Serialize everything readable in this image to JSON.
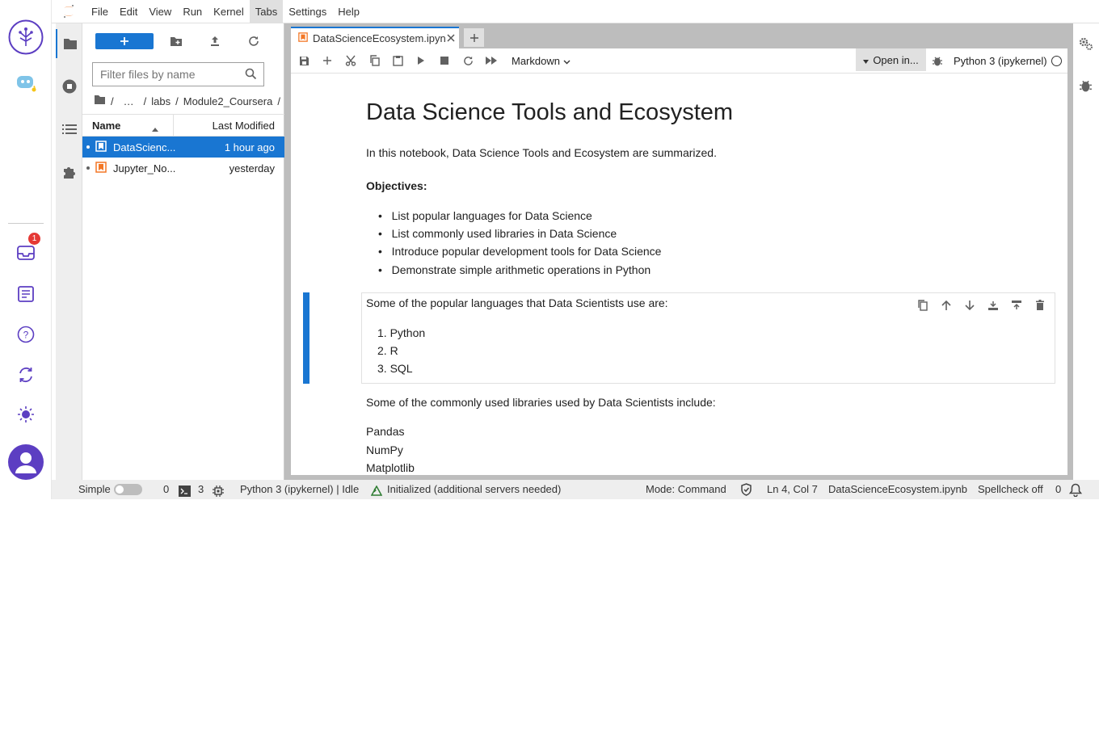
{
  "menubar": {
    "items": [
      "File",
      "Edit",
      "View",
      "Run",
      "Kernel",
      "Tabs",
      "Settings",
      "Help"
    ]
  },
  "rail": {
    "notification_count": "1"
  },
  "filebrowser": {
    "filter_placeholder": "Filter files by name",
    "breadcrumb": {
      "root": "/",
      "ellipsis": "…",
      "path1": "labs",
      "path2": "Module2_Coursera",
      "sep": "/"
    },
    "columns": {
      "name": "Name",
      "modified": "Last Modified"
    },
    "files": [
      {
        "name": "DataScienc...",
        "modified": "1 hour ago"
      },
      {
        "name": "Jupyter_No...",
        "modified": "yesterday"
      }
    ]
  },
  "tab": {
    "title": "DataScienceEcosystem.ipynb"
  },
  "toolbar": {
    "cell_type": "Markdown",
    "open_in": "Open in...",
    "kernel": "Python 3 (ipykernel)"
  },
  "notebook": {
    "title": "Data Science Tools and Ecosystem",
    "intro": "In this notebook, Data Science Tools and Ecosystem are summarized.",
    "objectives_label": "Objectives:",
    "objectives": [
      "List popular languages for Data Science",
      "List commonly used libraries in Data Science",
      "Introduce popular development tools for Data Science",
      "Demonstrate simple arithmetic operations in Python"
    ],
    "languages_intro": "Some of the popular languages that Data Scientists use are:",
    "languages": [
      "Python",
      "R",
      "SQL"
    ],
    "libraries_intro": "Some of the commonly used libraries used by Data Scientists include:",
    "libraries": [
      "Pandas",
      "NumPy",
      "Matplotlib"
    ]
  },
  "statusbar": {
    "mode_label": "Simple",
    "zero": "0",
    "terminals": "3",
    "kernel_status": "Python 3 (ipykernel) | Idle",
    "lsp": "Initialized (additional servers needed)",
    "mode": "Mode: Command",
    "cursor": "Ln 4, Col 7",
    "filename": "DataScienceEcosystem.ipynb",
    "spellcheck": "Spellcheck off",
    "notifications": "0"
  },
  "colors": {
    "accent": "#1976d2",
    "notebook_orange": "#f37726",
    "rail_purple": "#5c3ec2"
  }
}
